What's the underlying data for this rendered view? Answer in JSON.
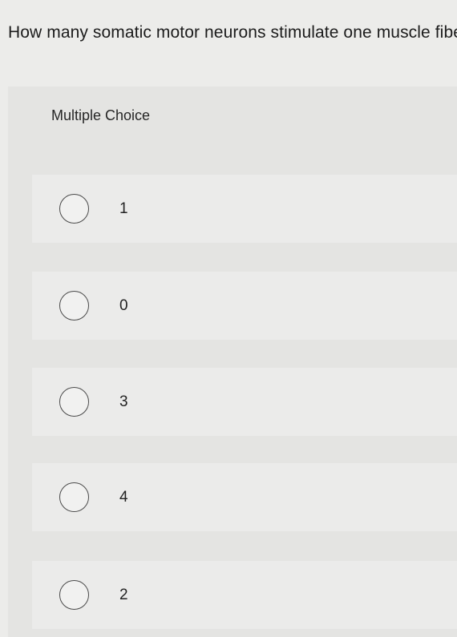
{
  "question": {
    "text": "How many somatic motor neurons stimulate one muscle fiber?"
  },
  "section": {
    "label": "Multiple Choice"
  },
  "options": [
    {
      "label": "1"
    },
    {
      "label": "0"
    },
    {
      "label": "3"
    },
    {
      "label": "4"
    },
    {
      "label": "2"
    }
  ]
}
